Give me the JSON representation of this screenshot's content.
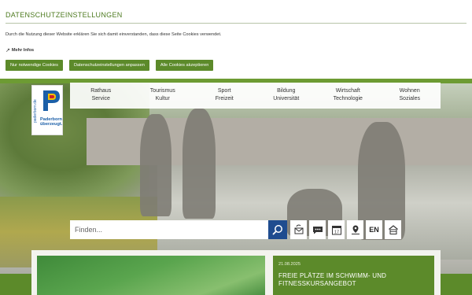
{
  "cookie": {
    "title": "DATENSCHUTZEINSTELLUNGEN",
    "text": "Durch die Nutzung dieser Website erklären Sie sich damit einverstanden, dass diese Seite Cookies verwendet.",
    "more_link": "Mehr Infos",
    "buttons": [
      "Nur notwendige Cookies",
      "Datenschutzeinstellungen anpassen",
      "Alle Cookies akzeptieren"
    ]
  },
  "logo": {
    "side_text": "paderborn.de",
    "name_line1": "Paderborn",
    "name_line2": "überzeugt."
  },
  "nav": [
    {
      "line1": "Rathaus",
      "line2": "Service"
    },
    {
      "line1": "Tourismus",
      "line2": "Kultur"
    },
    {
      "line1": "Sport",
      "line2": "Freizeit"
    },
    {
      "line1": "Bildung",
      "line2": "Universität"
    },
    {
      "line1": "Wirtschaft",
      "line2": "Technologie"
    },
    {
      "line1": "Wohnen",
      "line2": "Soziales"
    }
  ],
  "search": {
    "placeholder": "Finden..."
  },
  "tools": {
    "language": "EN",
    "calendar_day": "17",
    "icons": [
      "search-icon",
      "mail-refresh-icon",
      "chat-icon",
      "calendar-icon",
      "map-pin-icon",
      "language-toggle",
      "home-icon"
    ]
  },
  "news": {
    "date": "21.08.2025",
    "title_line1": "FREIE PLÄTZE IM SCHWIMM- UND",
    "title_line2": "FITNESSKURSANGEBOT"
  },
  "colors": {
    "brand_green": "#5c8a2a",
    "search_blue": "#1f4c8f",
    "logo_blue": "#1b5fa8",
    "logo_yellow": "#f2c200",
    "logo_red": "#d0202a"
  }
}
